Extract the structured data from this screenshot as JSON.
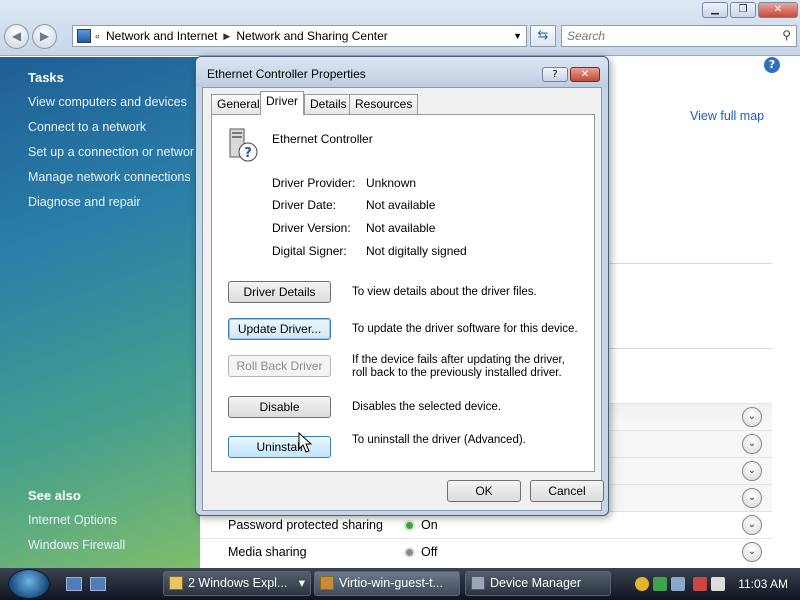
{
  "explorer": {
    "breadcrumb": [
      "Network and Internet",
      "Network and Sharing Center"
    ],
    "search_placeholder": "Search",
    "view_full_map": "View full map",
    "tasks_title": "Tasks",
    "tasks": [
      "View computers and devices",
      "Connect to a network",
      "Set up a connection or network",
      "Manage network connections",
      "Diagnose and repair"
    ],
    "see_also_title": "See also",
    "see_also": [
      "Internet Options",
      "Windows Firewall"
    ],
    "sharing_rows": [
      {
        "label": "",
        "status": ""
      },
      {
        "label": "",
        "status": ""
      },
      {
        "label": "",
        "status": ""
      },
      {
        "label": "",
        "status": ""
      },
      {
        "label": "Password protected sharing",
        "status": "On",
        "status_color": "#3aa63a"
      },
      {
        "label": "Media sharing",
        "status": "Off",
        "status_color": "#8a8a8a"
      }
    ]
  },
  "dialog": {
    "title": "Ethernet Controller Properties",
    "help_label": "?",
    "close_label": "✕",
    "tabs": [
      "General",
      "Driver",
      "Details",
      "Resources"
    ],
    "active_tab": "Driver",
    "device_name": "Ethernet Controller",
    "properties": [
      {
        "key": "Driver Provider:",
        "value": "Unknown"
      },
      {
        "key": "Driver Date:",
        "value": "Not available"
      },
      {
        "key": "Driver Version:",
        "value": "Not available"
      },
      {
        "key": "Digital Signer:",
        "value": "Not digitally signed"
      }
    ],
    "actions": [
      {
        "label": "Driver Details",
        "description": "To view details about the driver files."
      },
      {
        "label": "Update Driver...",
        "description": "To update the driver software for this device."
      },
      {
        "label": "Roll Back Driver",
        "description": "If the device fails after updating the driver, roll back to the previously installed driver."
      },
      {
        "label": "Disable",
        "description": "Disables the selected device."
      },
      {
        "label": "Uninstall",
        "description": "To uninstall the driver (Advanced)."
      }
    ],
    "ok_label": "OK",
    "cancel_label": "Cancel"
  },
  "taskbar": {
    "buttons": [
      {
        "label": "2 Windows Expl...",
        "dropdown": "▾"
      },
      {
        "label": "Virtio-win-guest-t..."
      },
      {
        "label": "Device Manager"
      }
    ],
    "clock": "11:03 AM"
  }
}
